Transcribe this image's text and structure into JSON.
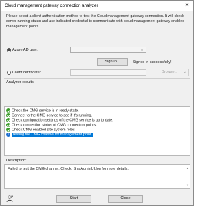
{
  "window": {
    "title": "Cloud management gateway connection analyzer",
    "close_glyph": "✕"
  },
  "intro": "Please select a client authentication method to test the Cloud management gateway connection. It will check server running status and use indicated credential to communicate with cloud management gateway enabled management points.",
  "auth": {
    "azure_label": "Azure AD user:",
    "azure_selected": true,
    "azure_value": "",
    "sign_in_button": "Sign In...",
    "signed_in_status": "Signed in successfully!",
    "client_cert_label": "Client certificate:",
    "client_cert_selected": false,
    "client_cert_value": "",
    "browse_button": "Browse..."
  },
  "results": {
    "label": "Analyzer results:",
    "rows": [
      {
        "icon": "check-icon",
        "status": "ok",
        "text": "Check the CMG service is in ready state."
      },
      {
        "icon": "check-icon",
        "status": "ok",
        "text": "Connect to the CMG service to see if it's running."
      },
      {
        "icon": "check-icon",
        "status": "ok",
        "text": "Check configuration settings of the CMG service is up to date."
      },
      {
        "icon": "check-icon",
        "status": "ok",
        "text": "Check connection status of CMG connection points."
      },
      {
        "icon": "check-icon",
        "status": "ok",
        "text": "Check CMG enabled site system roles"
      },
      {
        "icon": "info-icon",
        "status": "info",
        "text": "Testing the CMG channel for management point.",
        "selected": true
      }
    ]
  },
  "description": {
    "label": "Description:",
    "text": "Failed to test the CMG channel. Check: SmsAdminUI.log for more details."
  },
  "footer": {
    "start_button": "Start",
    "close_button": "Close"
  },
  "colors": {
    "selection": "#0078d7",
    "ok": "#3a9b2a",
    "info": "#1e6fd0"
  }
}
